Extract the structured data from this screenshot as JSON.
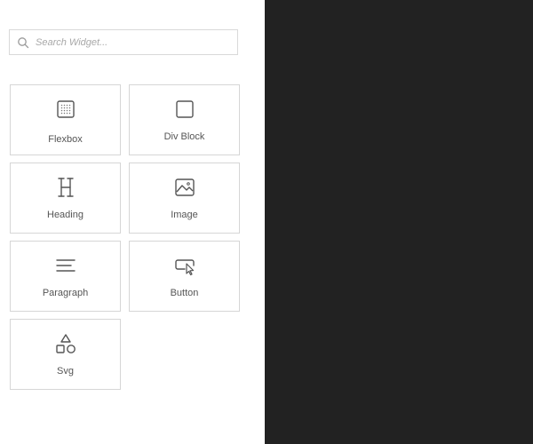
{
  "search": {
    "placeholder": "Search Widget...",
    "value": "",
    "icon": "search-icon"
  },
  "widgets": [
    {
      "label": "Flexbox",
      "icon": "flexbox-icon"
    },
    {
      "label": "Div Block",
      "icon": "div-block-icon"
    },
    {
      "label": "Heading",
      "icon": "heading-icon"
    },
    {
      "label": "Image",
      "icon": "image-icon"
    },
    {
      "label": "Paragraph",
      "icon": "paragraph-icon"
    },
    {
      "label": "Button",
      "icon": "button-icon"
    },
    {
      "label": "Svg",
      "icon": "svg-shapes-icon"
    }
  ],
  "colors": {
    "sidebar_background": "#ffffff",
    "canvas_background": "#222222",
    "tile_border": "#d6d6d6",
    "label_text": "#555555",
    "icon_stroke": "#555555"
  }
}
